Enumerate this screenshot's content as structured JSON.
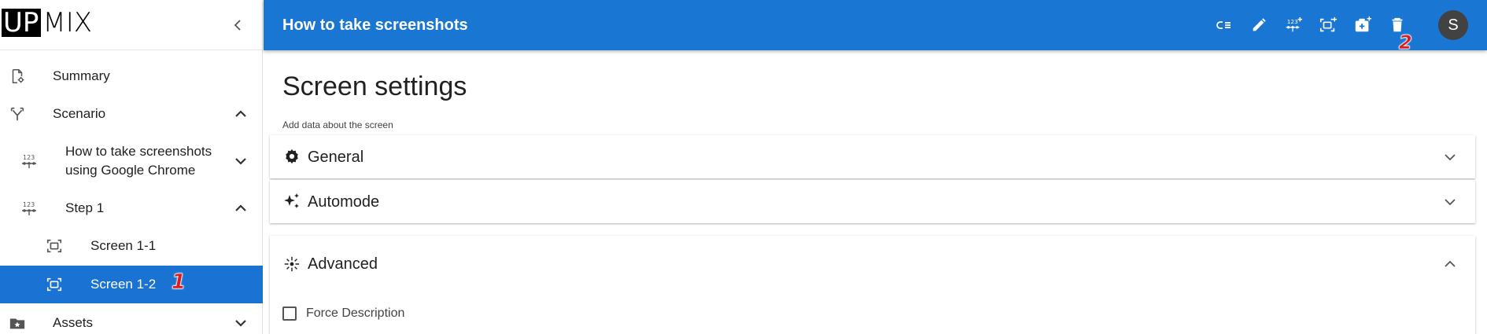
{
  "logo": {
    "box_text": "UP",
    "rest_text": "MIX"
  },
  "sidebar": {
    "items": [
      {
        "label": "Summary",
        "icon": "file-gear-icon"
      },
      {
        "label": "Scenario",
        "icon": "fork-icon"
      },
      {
        "label": "How to take screenshots using Google Chrome",
        "icon": "numbered-steps-icon"
      },
      {
        "label": "Step 1",
        "icon": "numbered-steps-icon"
      },
      {
        "label": "Screen 1-1",
        "icon": "screenshot-frame-icon"
      },
      {
        "label": "Screen 1-2",
        "icon": "screenshot-frame-icon",
        "active": true
      },
      {
        "label": "Assets",
        "icon": "starred-folder-icon"
      }
    ],
    "annotation_1": "1"
  },
  "appbar": {
    "title": "How to take screenshots",
    "annotation_2": "2",
    "avatar_initial": "S",
    "tools": [
      "list-tree-icon",
      "edit-icon",
      "add-step-icon",
      "add-screen-icon",
      "add-photo-icon",
      "delete-icon"
    ]
  },
  "main": {
    "title": "Screen settings",
    "subtitle": "Add data about the screen",
    "panels": [
      {
        "label": "General",
        "icon": "gear-icon",
        "expanded": false
      },
      {
        "label": "Automode",
        "icon": "sparkle-icon",
        "expanded": false
      },
      {
        "label": "Advanced",
        "icon": "center-focus-icon",
        "expanded": true
      }
    ],
    "force_description_label": "Force Description"
  },
  "colors": {
    "primary": "#1976d2",
    "active_item": "#1a73d2",
    "annotation": "#e01a1a"
  }
}
